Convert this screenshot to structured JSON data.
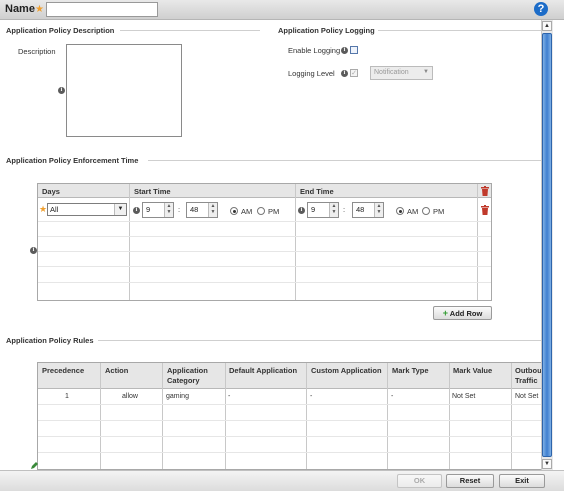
{
  "header": {
    "name_label": "Name",
    "name_value": "",
    "help": "?"
  },
  "description_section": {
    "title": "Application Policy Description",
    "description_label": "Description",
    "description_value": ""
  },
  "logging_section": {
    "title": "Application Policy Logging",
    "enable_logging_label": "Enable Logging",
    "enable_logging_checked": false,
    "logging_level_label": "Logging Level",
    "logging_level_value": "Notification"
  },
  "enforcement_section": {
    "title": "Application Policy Enforcement Time",
    "columns": [
      "Days",
      "Start Time",
      "End Time"
    ],
    "row": {
      "days": "All",
      "start_hour": "9",
      "start_minute": "48",
      "start_am_label": "AM",
      "start_pm_label": "PM",
      "start_ampm": "AM",
      "end_hour": "9",
      "end_minute": "48",
      "end_am_label": "AM",
      "end_pm_label": "PM",
      "end_ampm": "AM",
      "colon": ":"
    },
    "add_row_label": "Add Row"
  },
  "rules_section": {
    "title": "Application Policy Rules",
    "columns": [
      "Precedence",
      "Action",
      "Application\nCategory",
      "Default Application",
      "Custom Application",
      "Mark Type",
      "Mark Value",
      "Outbou\nTraffic"
    ],
    "rows": [
      {
        "precedence": "1",
        "action": "allow",
        "category": "gaming",
        "default_app": "-",
        "custom_app": "-",
        "mark_type": "-",
        "mark_value": "Not Set",
        "outbound": "Not Set"
      }
    ]
  },
  "footer": {
    "ok_label": "OK",
    "reset_label": "Reset",
    "exit_label": "Exit"
  },
  "colors": {
    "accent_blue": "#1c6cc8",
    "required_star": "#f0a030",
    "delete_red": "#c0392b",
    "add_green": "#2e9a2e"
  }
}
